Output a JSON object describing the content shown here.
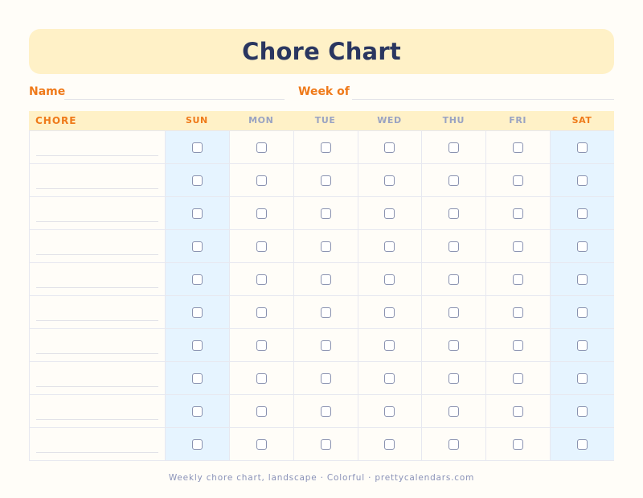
{
  "title": "Chore Chart",
  "fields": {
    "name_label": "Name",
    "week_label": "Week of"
  },
  "table": {
    "chore_header": "CHORE",
    "days": [
      {
        "label": "SUN",
        "weekend": true
      },
      {
        "label": "MON",
        "weekend": false
      },
      {
        "label": "TUE",
        "weekend": false
      },
      {
        "label": "WED",
        "weekend": false
      },
      {
        "label": "THU",
        "weekend": false
      },
      {
        "label": "FRI",
        "weekend": false
      },
      {
        "label": "SAT",
        "weekend": true
      }
    ],
    "row_count": 10
  },
  "colors": {
    "accent": "#ef7a1a",
    "title": "#2a3660",
    "banner": "#fff1c7",
    "weekend_column": "#e6f4ff"
  },
  "footer": "Weekly chore chart, landscape · Colorful · prettycalendars.com"
}
